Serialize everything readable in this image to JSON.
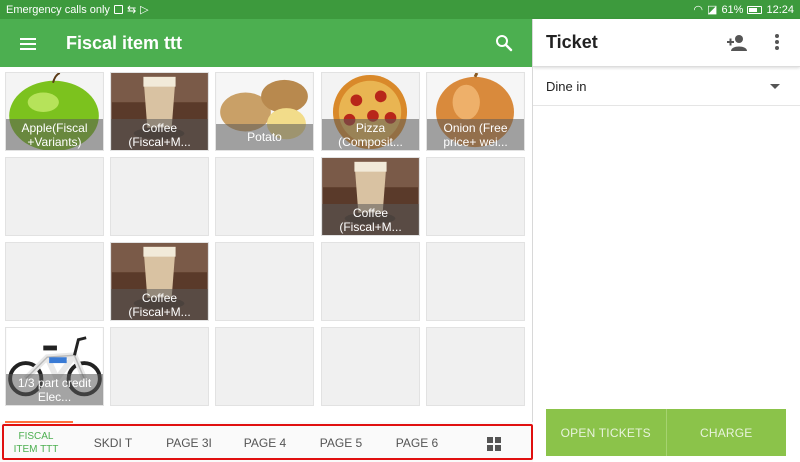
{
  "status_bar": {
    "carrier": "Emergency calls only",
    "battery": "61%",
    "time": "12:24"
  },
  "app_bar": {
    "title": "Fiscal item ttt",
    "menu_icon": "menu-icon",
    "search_icon": "search-icon",
    "color": "#4caf50"
  },
  "ticket": {
    "title": "Ticket",
    "dining_option": "Dine in",
    "open_tickets_label": "OPEN TICKETS",
    "charge_label": "CHARGE",
    "button_color": "#8bc34a"
  },
  "items": [
    {
      "label": "Apple(Fiscal +Variants)",
      "image": "apple"
    },
    {
      "label": "Coffee (Fiscal+M...",
      "image": "coffee"
    },
    {
      "label": "Potato",
      "image": "potato"
    },
    {
      "label": "Pizza (Composit...",
      "image": "pizza"
    },
    {
      "label": "Onion (Free price+ wei...",
      "image": "onion"
    },
    {
      "label": "Coffee (Fiscal+M...",
      "image": "coffee"
    },
    {
      "label": "Coffee (Fiscal+M...",
      "image": "coffee"
    },
    {
      "label": "1/3 part credit Elec...",
      "image": "bicycle"
    }
  ],
  "tabs": [
    {
      "label": "FISCAL ITEM TTT",
      "active": true
    },
    {
      "label": "SKDI T",
      "active": false
    },
    {
      "label": "PAGE 3I",
      "active": false
    },
    {
      "label": "PAGE 4",
      "active": false
    },
    {
      "label": "PAGE 5",
      "active": false
    },
    {
      "label": "PAGE 6",
      "active": false
    }
  ],
  "highlight_color": "#e01010"
}
